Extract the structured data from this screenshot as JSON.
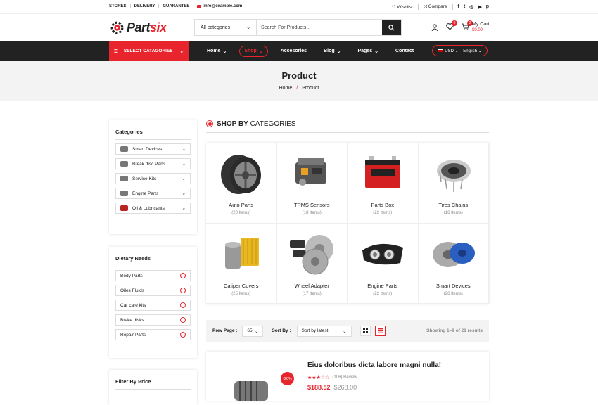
{
  "topbar": {
    "links": [
      "STORES",
      "DELIVERY",
      "GUARANTEE"
    ],
    "email": "info@example.com",
    "wishlist": "Wishlist",
    "compare": "Compare",
    "social": [
      "f",
      "t",
      "ig",
      "yt",
      "p"
    ]
  },
  "brand": {
    "part1": "Part",
    "part2": "six",
    "accent": "#e8242d"
  },
  "search": {
    "category": "All categories",
    "placeholder": "Search For Products..."
  },
  "header": {
    "cart_count": "2",
    "wish_count": "0",
    "cart_label": "My Cart",
    "cart_amount": "$0.00"
  },
  "nav": {
    "categories_button": "SELECT CATAGORIES",
    "items": [
      "Home",
      "Shop",
      "Accesories",
      "Blog",
      "Pages",
      "Contact"
    ],
    "currency": "USD",
    "language": "English"
  },
  "hero": {
    "title": "Product",
    "crumb_home": "Home",
    "crumb_current": "Product"
  },
  "sidebar": {
    "categories_title": "Categories",
    "categories": [
      "Smart Devices",
      "Break disc Parts",
      "Service Kits",
      "Engine Parts",
      "Oil & Lubricants"
    ],
    "dietary_title": "Dietary Needs",
    "dietary": [
      "Body Parts",
      "Oiles Fluids",
      "Car care kits",
      "Brake disks",
      "Repair Parts"
    ],
    "price_title": "Filter By Price"
  },
  "shop_by": {
    "bold": "SHOP BY",
    "rest": " CATEGORIES"
  },
  "category_cards": [
    {
      "name": "Auto Parts",
      "count": "(20 Items)",
      "icon": "wheel-rim-icon"
    },
    {
      "name": "TPMS Sensors",
      "count": "(18 Items)",
      "icon": "engine-block-icon"
    },
    {
      "name": "Parts Box",
      "count": "(22 Items)",
      "icon": "battery-icon"
    },
    {
      "name": "Tires Chains",
      "count": "(16 Items)",
      "icon": "air-filter-icon"
    },
    {
      "name": "Caliper Covers",
      "count": "(25 Items)",
      "icon": "oil-filter-icon"
    },
    {
      "name": "Wheel Adapter",
      "count": "(17 Items)",
      "icon": "brake-disc-icon"
    },
    {
      "name": "Engine Parts",
      "count": "(22 Items)",
      "icon": "headlight-icon"
    },
    {
      "name": "Smart Devices",
      "count": "(26 Items)",
      "icon": "disc-caliper-icon"
    }
  ],
  "toolbar": {
    "prev_label": "Prev Page :",
    "prev_value": "65",
    "sort_label": "Sort By :",
    "sort_value": "Sort by latest",
    "showing": "Showing 1–9 of 21 results"
  },
  "product": {
    "title": "Eius doloribus dicta labore magni nulla!",
    "reviews": "(106) Review",
    "price": "$188.52",
    "old_price": "$268.00",
    "discount": "-20%",
    "rating": 3,
    "rating_max": 5
  }
}
